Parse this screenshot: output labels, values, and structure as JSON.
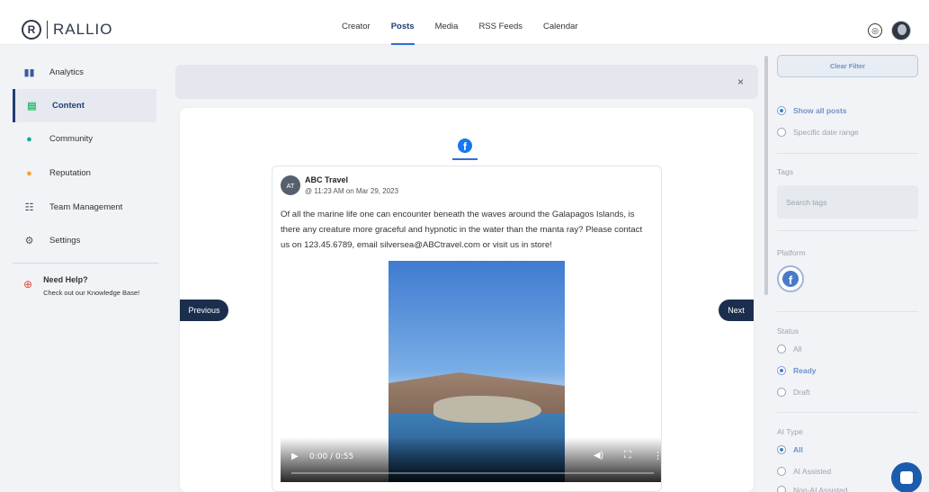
{
  "brand": {
    "name": "RALLIO",
    "mark": "R"
  },
  "topnav": {
    "items": [
      {
        "label": "Creator"
      },
      {
        "label": "Posts"
      },
      {
        "label": "Media"
      },
      {
        "label": "RSS Feeds"
      },
      {
        "label": "Calendar"
      }
    ],
    "active": "Posts"
  },
  "sidebar": {
    "items": [
      {
        "label": "Analytics"
      },
      {
        "label": "Content"
      },
      {
        "label": "Community"
      },
      {
        "label": "Reputation"
      },
      {
        "label": "Team Management"
      },
      {
        "label": "Settings"
      }
    ],
    "active": "Content",
    "help_title": "Need Help?",
    "help_sub": "Check out our Knowledge Base!"
  },
  "post": {
    "avatar_initials": "AT",
    "author": "ABC Travel",
    "time": "@ 11:23 AM on Mar 29, 2023",
    "text": "Of all the marine life one can encounter beneath the waves around the Galapagos Islands, is there any creature more graceful and hypnotic in the water than the manta ray? Please contact us on 123.45.6789, email silversea@ABCtravel.com or visit us in store!",
    "video_time": "0:00 / 0:55"
  },
  "modal": {
    "prev_label": "Previous",
    "next_label": "Next",
    "close_glyph": "×"
  },
  "filters": {
    "clear_label": "Clear Filter",
    "date": [
      "Show all posts",
      "Specific date range"
    ],
    "date_selected": 0,
    "tags_label": "Tags",
    "tags_placeholder": "Search tags",
    "platform_label": "Platform",
    "status_label": "Status",
    "status": [
      "All",
      "Ready",
      "Draft"
    ],
    "status_selected": 1,
    "ai_type_label": "AI Type",
    "ai_type": [
      "All",
      "AI Assisted",
      "Non-AI Assisted"
    ],
    "ai_type_selected": 0
  },
  "colors": {
    "accent": "#1f3d73",
    "brand_blue": "#1877f2",
    "button": "#1c2e4e"
  }
}
